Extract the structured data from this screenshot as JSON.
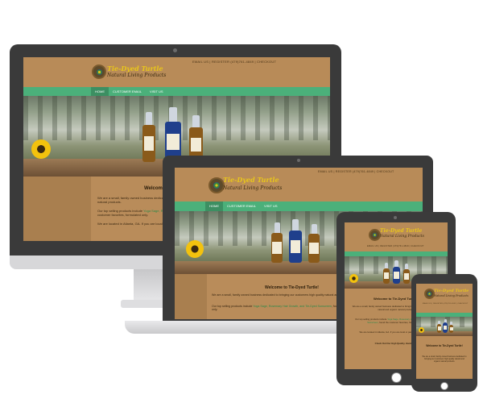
{
  "site": {
    "logo_title": "Tie-Dyed Turtle",
    "logo_subtitle": "Natural Living Products",
    "contact": "EMAIL US | REGISTER  (479)761-4849 | CHECKOUT",
    "nav": [
      "HOME",
      "CUSTOMER EMAIL",
      "VISIT US"
    ],
    "welcome": "Welcome to Tie-Dyed Turtle!",
    "para1": "We are a small, family owned business dedicated to bringing our customers high quality natural and organic natural products.",
    "para2_before": "Our top selling products include ",
    "para2_highlight": "Yoga Sage, Rosemary Hair Growth, and Tie-Dyed Sunscreen",
    "para2_after": ", found the customer favorites, formulated only.",
    "para3": "We are located in Atlanta, GA. If you are local or passing through, stop in!",
    "para4": "Check Out Our High Quality, Handmade"
  },
  "colors": {
    "nav_green": "#4bb07a",
    "header_tan": "#b88b58",
    "logo_yellow": "#e8c51c",
    "device_frame": "#3a3a3a"
  }
}
